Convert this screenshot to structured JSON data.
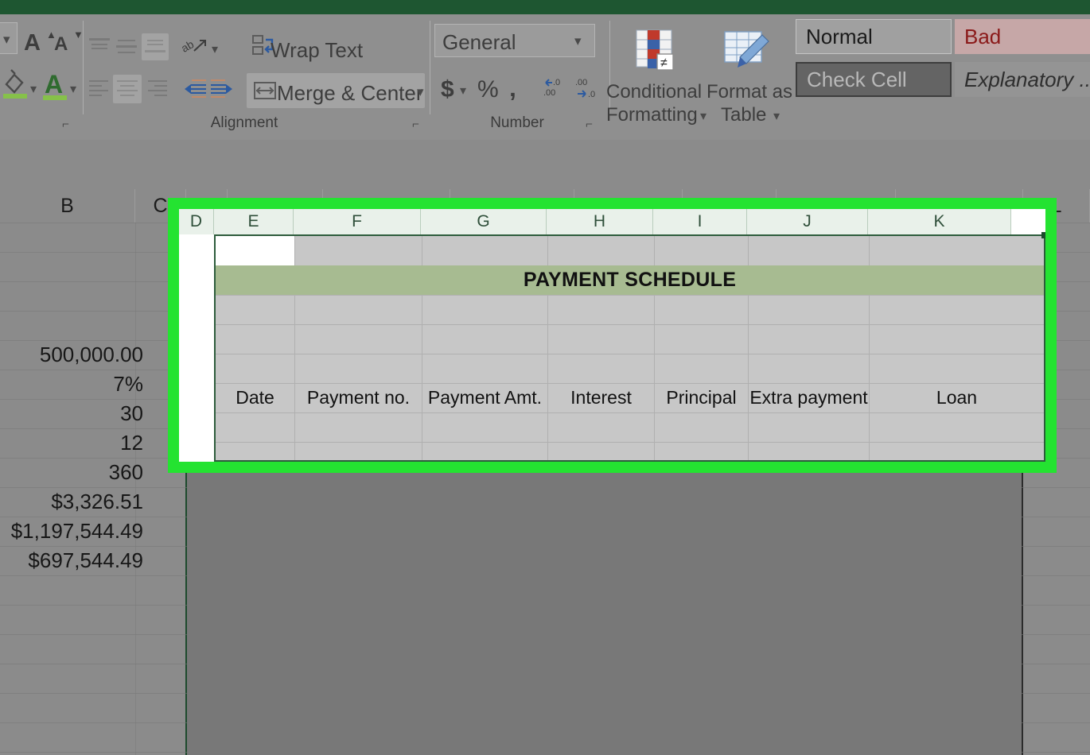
{
  "app": {
    "accent_green": "#1e5631",
    "highlight_green": "#24e331",
    "title_band_color": "#a7bb91"
  },
  "ribbon": {
    "groups": [
      {
        "label": "Alignment"
      },
      {
        "label": "Number"
      }
    ],
    "font_group": {
      "grow_font_label": "A",
      "shrink_font_label": "A",
      "font_color_label": "A"
    },
    "alignment_group": {
      "wrap_text_label": "Wrap Text",
      "merge_center_label": "Merge & Center",
      "orientation_icon": "orientation-icon",
      "decrease_indent_icon": "decrease-indent-icon",
      "increase_indent_icon": "increase-indent-icon"
    },
    "number_group": {
      "format_value": "General",
      "currency_label": "$",
      "percent_label": "%",
      "comma_label": "‚",
      "increase_decimal_label": ".00",
      "decrease_decimal_label": ".00"
    },
    "styles_group": {
      "conditional_formatting_line1": "Conditional",
      "conditional_formatting_line2": "Formatting",
      "format_as_table_line1": "Format as",
      "format_as_table_line2": "Table",
      "cells": [
        {
          "label": "Normal",
          "state": "normal"
        },
        {
          "label": "Bad",
          "state": "bad"
        },
        {
          "label": "Check Cell",
          "state": "check"
        },
        {
          "label": "Explanatory ...",
          "state": "explanatory"
        }
      ]
    }
  },
  "sheet": {
    "column_headers": [
      "B",
      "C",
      "D",
      "E",
      "F",
      "G",
      "H",
      "I",
      "J",
      "K",
      "L"
    ],
    "column_b_values": [
      "500,000.00",
      "7%",
      "30",
      "12",
      "360",
      "$3,326.51",
      "$1,197,544.49",
      "$697,544.49"
    ]
  },
  "card": {
    "column_headers": [
      "D",
      "E",
      "F",
      "G",
      "H",
      "I",
      "J",
      "K"
    ],
    "title": "PAYMENT SCHEDULE",
    "table_headers": [
      "Date",
      "Payment no.",
      "Payment Amt.",
      "Interest",
      "Principal",
      "Extra payment",
      "Loan"
    ]
  }
}
